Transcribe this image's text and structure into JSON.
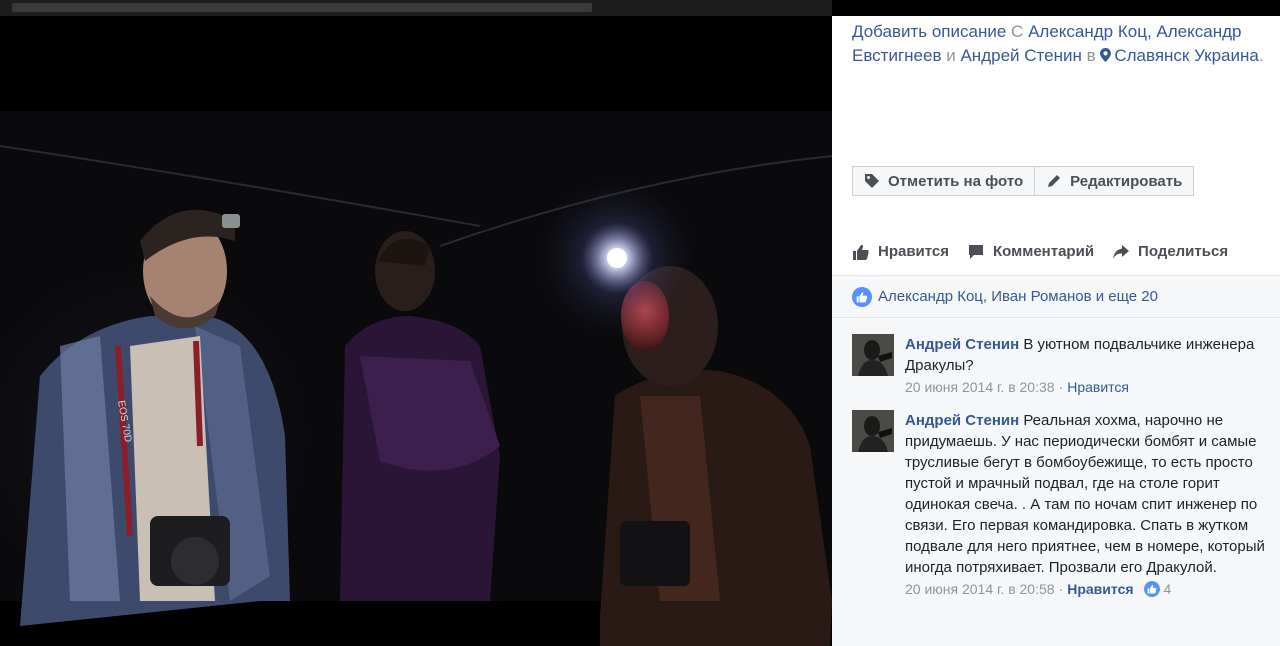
{
  "description": {
    "add_label": "Добавить описание",
    "with_word": "С",
    "tag1": "Александр Коц,",
    "tag2": "Александр Евстигнеев",
    "and_word": "и",
    "tag3": "Андрей Стенин",
    "in_word": "в",
    "location": "Славянск Украина",
    "period": "."
  },
  "buttons": {
    "tag_photo": "Отметить на фото",
    "edit": "Редактировать"
  },
  "actions": {
    "like": "Нравится",
    "comment": "Комментарий",
    "share": "Поделиться"
  },
  "likes_summary": "Александр Коц, Иван Романов и еще 20",
  "comments": [
    {
      "author": "Андрей Стенин",
      "text": " В уютном подвальчике инженера Дракулы?",
      "time": "20 июня 2014 г. в 20:38",
      "separator": "·",
      "like_label": "Нравится",
      "like_count": ""
    },
    {
      "author": "Андрей Стенин",
      "text": " Реальная хохма, нарочно не придумаешь. У нас периодически бомбят и самые трусливые бегут в бомбоубежище, то есть просто пустой и мрачный подвал, где на столе горит одинокая свеча. . А там по ночам спит инженер по связи. Его первая командировка. Спать в жутком подвале для него приятнее, чем в номере, который иногда потряхивает. Прозвали его Дракулой.",
      "time": "20 июня 2014 г. в 20:58",
      "separator": "·",
      "like_label": "Нравится",
      "like_count": "4"
    }
  ],
  "photo": {
    "camera_label": "EOS 70D"
  },
  "colors": {
    "link": "#365899",
    "muted": "#90949c",
    "like_blue": "#5890ff"
  }
}
